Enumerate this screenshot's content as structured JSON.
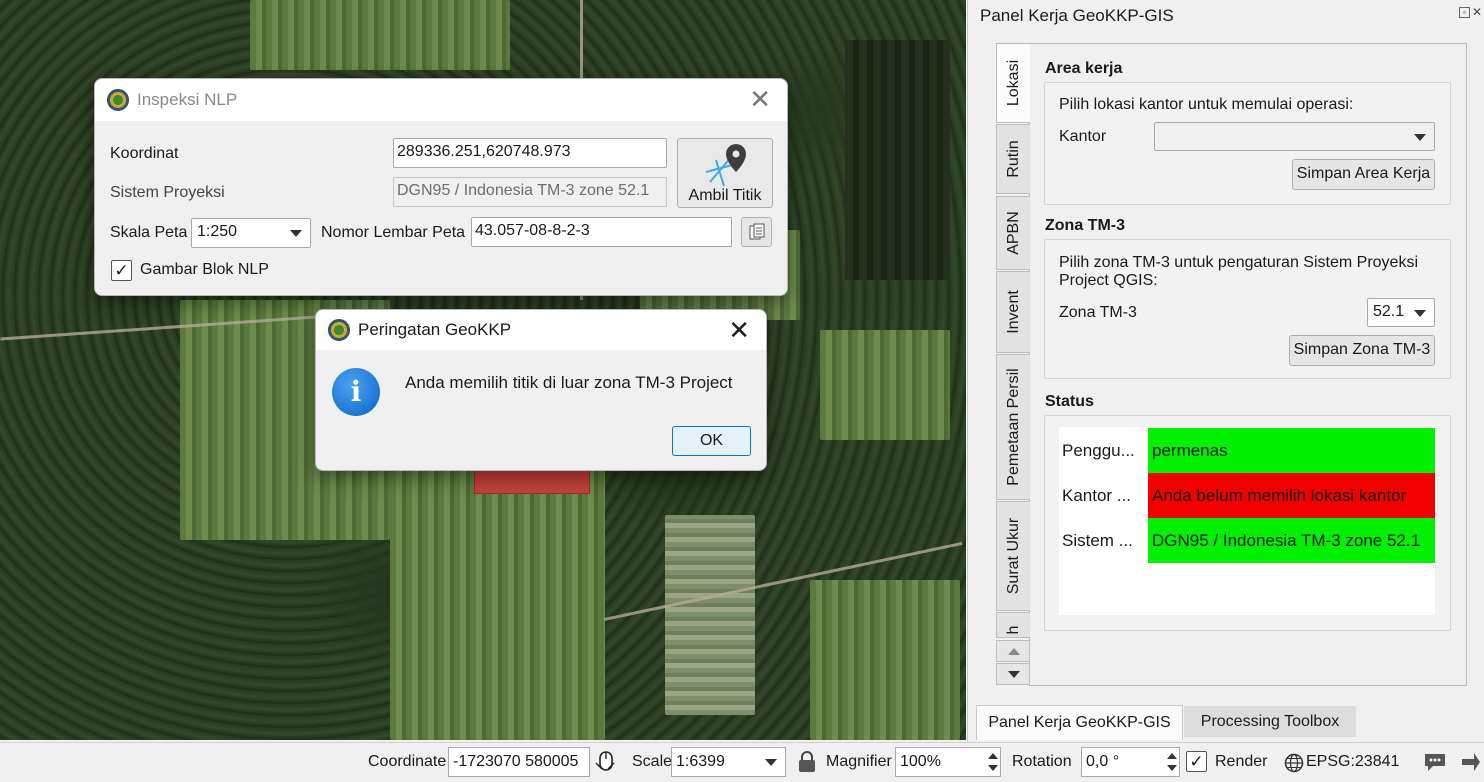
{
  "inspeksi": {
    "title": "Inspeksi NLP",
    "koordinat_label": "Koordinat",
    "koordinat_value": "289336.251,620748.973",
    "sistem_label": "Sistem Proyeksi",
    "sistem_value": "DGN95 / Indonesia TM-3 zone 52.1",
    "ambil_label": "Ambil Titik",
    "skala_label": "Skala Peta",
    "skala_value": "1:250",
    "nomor_label": "Nomor Lembar Peta",
    "nomor_value": "43.057-08-8-2-3",
    "gambar_label": "Gambar Blok NLP",
    "gambar_checked": "✓"
  },
  "peringatan": {
    "title": "Peringatan GeoKKP",
    "message": "Anda memilih titik di luar zona TM-3 Project",
    "ok_label": "OK",
    "info_glyph": "i"
  },
  "panel": {
    "title": "Panel Kerja GeoKKP-GIS",
    "tabs": [
      "Lokasi",
      "Rutin",
      "APBN",
      "Invent",
      "Pemetaan Persil",
      "Surat Ukur",
      "h"
    ],
    "area_kerja": {
      "heading": "Area kerja",
      "prompt": "Pilih lokasi kantor untuk memulai operasi:",
      "kantor_label": "Kantor",
      "kantor_value": "",
      "simpan_label": "Simpan Area Kerja"
    },
    "zona": {
      "heading": "Zona TM-3",
      "prompt": "Pilih zona TM-3 untuk pengaturan Sistem Proyeksi Project QGIS:",
      "zona_label": "Zona TM-3",
      "zona_value": "52.1",
      "simpan_label": "Simpan Zona TM-3"
    },
    "status": {
      "heading": "Status",
      "rows": [
        {
          "key": "Penggu...",
          "value": "permenas",
          "color": "#00f000"
        },
        {
          "key": "Kantor ...",
          "value": "Anda belum memilih lokasi kantor",
          "color": "#f00000"
        },
        {
          "key": "Sistem ...",
          "value": "DGN95 / Indonesia TM-3 zone 52.1",
          "color": "#00f000"
        }
      ]
    },
    "bottom_tabs": [
      "Panel Kerja GeoKKP-GIS",
      "Processing Toolbox"
    ]
  },
  "statusbar": {
    "coordinate_label": "Coordinate",
    "coordinate_value": "-1723070 580005",
    "scale_label": "Scale",
    "scale_value": "1:6399",
    "magnifier_label": "Magnifier",
    "magnifier_value": "100%",
    "rotation_label": "Rotation",
    "rotation_value": "0,0 °",
    "render_label": "Render",
    "render_checked": "✓",
    "crs_label": "EPSG:23841"
  }
}
